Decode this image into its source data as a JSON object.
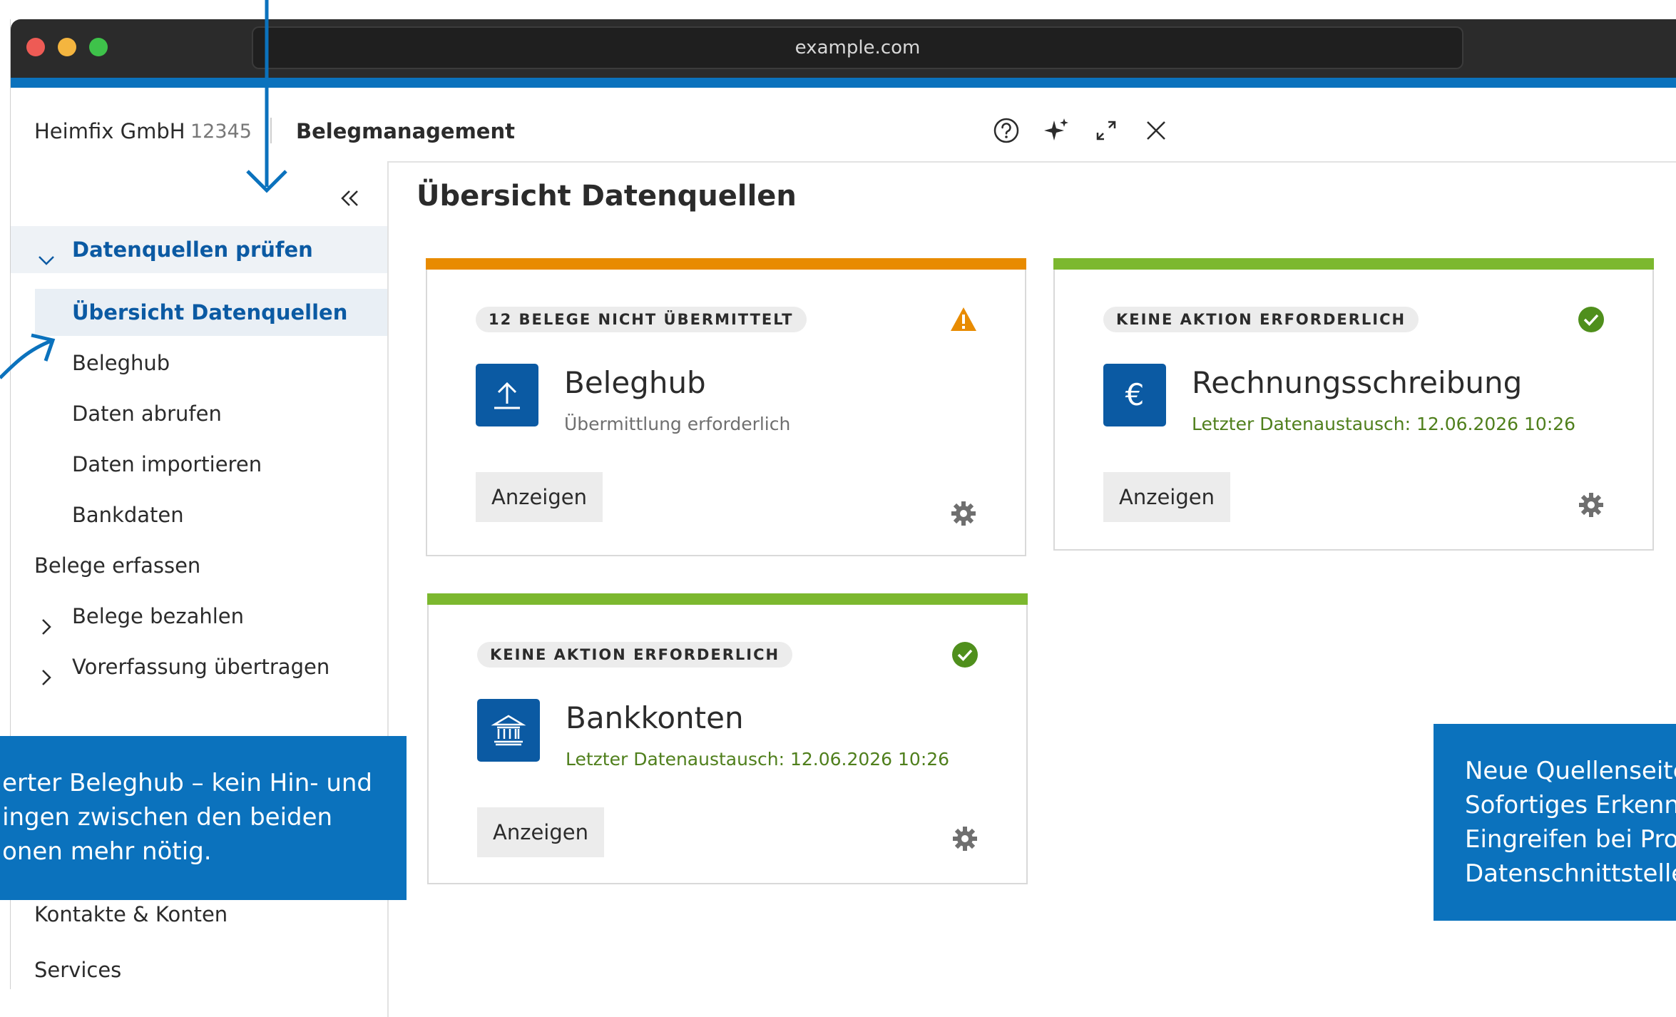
{
  "browser": {
    "url": "example.com"
  },
  "header": {
    "company": "Heimfix GmbH",
    "company_id": "12345",
    "app_title": "Belegmanagement",
    "icons": [
      "help-circle-icon",
      "sparkle-icon",
      "expand-icon",
      "close-icon"
    ]
  },
  "sidebar": {
    "group_open": "Datenquellen prüfen",
    "items": [
      {
        "label": "Übersicht Datenquellen",
        "active": true
      },
      {
        "label": "Beleghub"
      },
      {
        "label": "Daten abrufen"
      },
      {
        "label": "Daten importieren"
      },
      {
        "label": "Bankdaten"
      }
    ],
    "top_items": [
      {
        "label": "Belege erfassen"
      },
      {
        "label": "Belege bezahlen",
        "chevron": true
      },
      {
        "label": "Vorerfassung übertragen",
        "chevron": true
      },
      {
        "label": "Kontakte & Konten"
      },
      {
        "label": "Services"
      }
    ]
  },
  "main": {
    "title": "Übersicht Datenquellen",
    "cards": [
      {
        "badge": "12 BELEGE NICHT ÜBERMITTELT",
        "status": "warning",
        "icon": "upload-icon",
        "name": "Beleghub",
        "subtitle": "Übermittlung erforderlich",
        "button": "Anzeigen",
        "accent": "#e88b00"
      },
      {
        "badge": "KEINE AKTION ERFORDERLICH",
        "status": "ok",
        "icon": "euro-icon",
        "name": "Rechnungsschreibung",
        "subtitle": "Letzter Datenaustausch: 12.06.2026 10:26",
        "button": "Anzeigen",
        "accent": "#7cb82f"
      },
      {
        "badge": "KEINE AKTION ERFORDERLICH",
        "status": "ok",
        "icon": "bank-icon",
        "name": "Bankkonten",
        "subtitle": "Letzter Datenaustausch: 12.06.2026 10:26",
        "button": "Anzeigen",
        "accent": "#7cb82f"
      }
    ]
  },
  "callouts": {
    "left": "erter Beleghub – kein Hin- und\ningen zwischen den beiden\nonen mehr nötig.",
    "right": "Neue Quellenseite\nSofortiges Erkenn\nEingreifen bei Pro\nDatenschnittstelle"
  },
  "colors": {
    "brand_blue": "#0b72bd",
    "dark_blue": "#0b5aa3",
    "warning": "#e88b00",
    "ok": "#7cb82f",
    "ok_text": "#4f7f1c"
  }
}
